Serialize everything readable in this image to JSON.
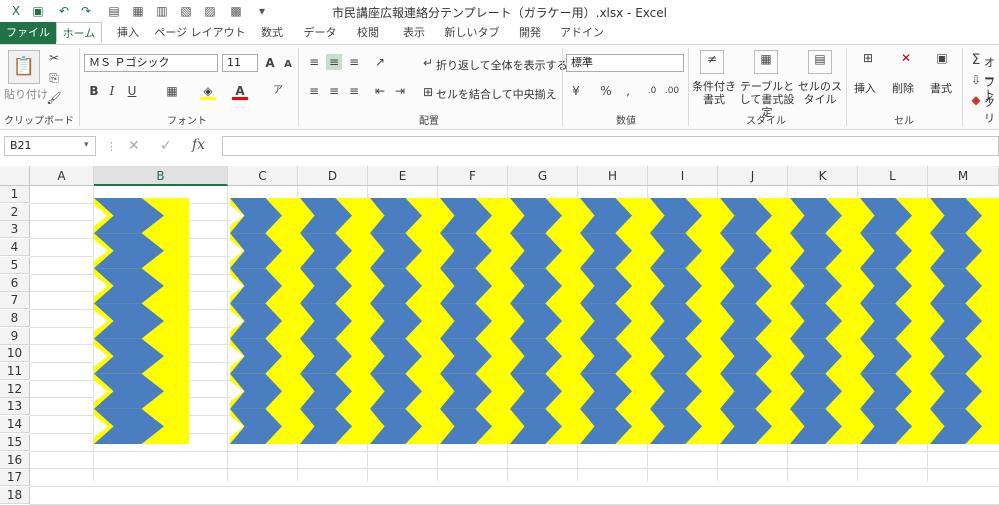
{
  "window": {
    "title": "市民講座広報連絡分テンプレート（ガラケー用）.xlsx - Excel"
  },
  "quick_access": [
    "save-icon",
    "undo-icon",
    "redo-icon",
    "print-preview-icon",
    "form-icon",
    "calculator-icon",
    "clipboard-icon",
    "calendar-icon",
    "macro-icon"
  ],
  "tabs": [
    "ファイル",
    "ホーム",
    "挿入",
    "ページ レイアウト",
    "数式",
    "データ",
    "校閲",
    "表示",
    "新しいタブ",
    "開発",
    "アドイン"
  ],
  "ribbon": {
    "clipboard": {
      "paste_label": "貼り付け",
      "group_label": "クリップボード"
    },
    "font": {
      "font_name": "ＭＳ Ｐゴシック",
      "font_size": "11",
      "group_label": "フォント"
    },
    "alignment": {
      "wrap_text": "折り返して全体を表示する",
      "merge_center": "セルを結合して中央揃え",
      "group_label": "配置"
    },
    "number": {
      "format": "標準",
      "group_label": "数値"
    },
    "styles": {
      "cond_format": "条件付き書式",
      "table_format": "テーブルとして書式設定",
      "cell_styles": "セルのスタイル",
      "group_label": "スタイル"
    },
    "cells": {
      "insert": "挿入",
      "delete": "削除",
      "format": "書式",
      "group_label": "セル"
    },
    "editing": {
      "autosum": "オート",
      "fill": "フィ",
      "clear": "クリ"
    }
  },
  "formula_bar": {
    "name_box": "B21",
    "formula": ""
  },
  "sheet": {
    "columns": [
      "A",
      "B",
      "C",
      "D",
      "E",
      "F",
      "G",
      "H",
      "I",
      "J",
      "K",
      "L",
      "M"
    ],
    "rows": [
      "1",
      "2",
      "3",
      "4",
      "5",
      "6",
      "7",
      "8",
      "9",
      "10",
      "11",
      "12",
      "13",
      "14",
      "15",
      "16",
      "17",
      "18"
    ],
    "selected_column": "B",
    "pattern_colors": {
      "blue": "#4a7ec0",
      "yellow": "#ffff00"
    }
  },
  "colors": {
    "accent": "#217346"
  }
}
